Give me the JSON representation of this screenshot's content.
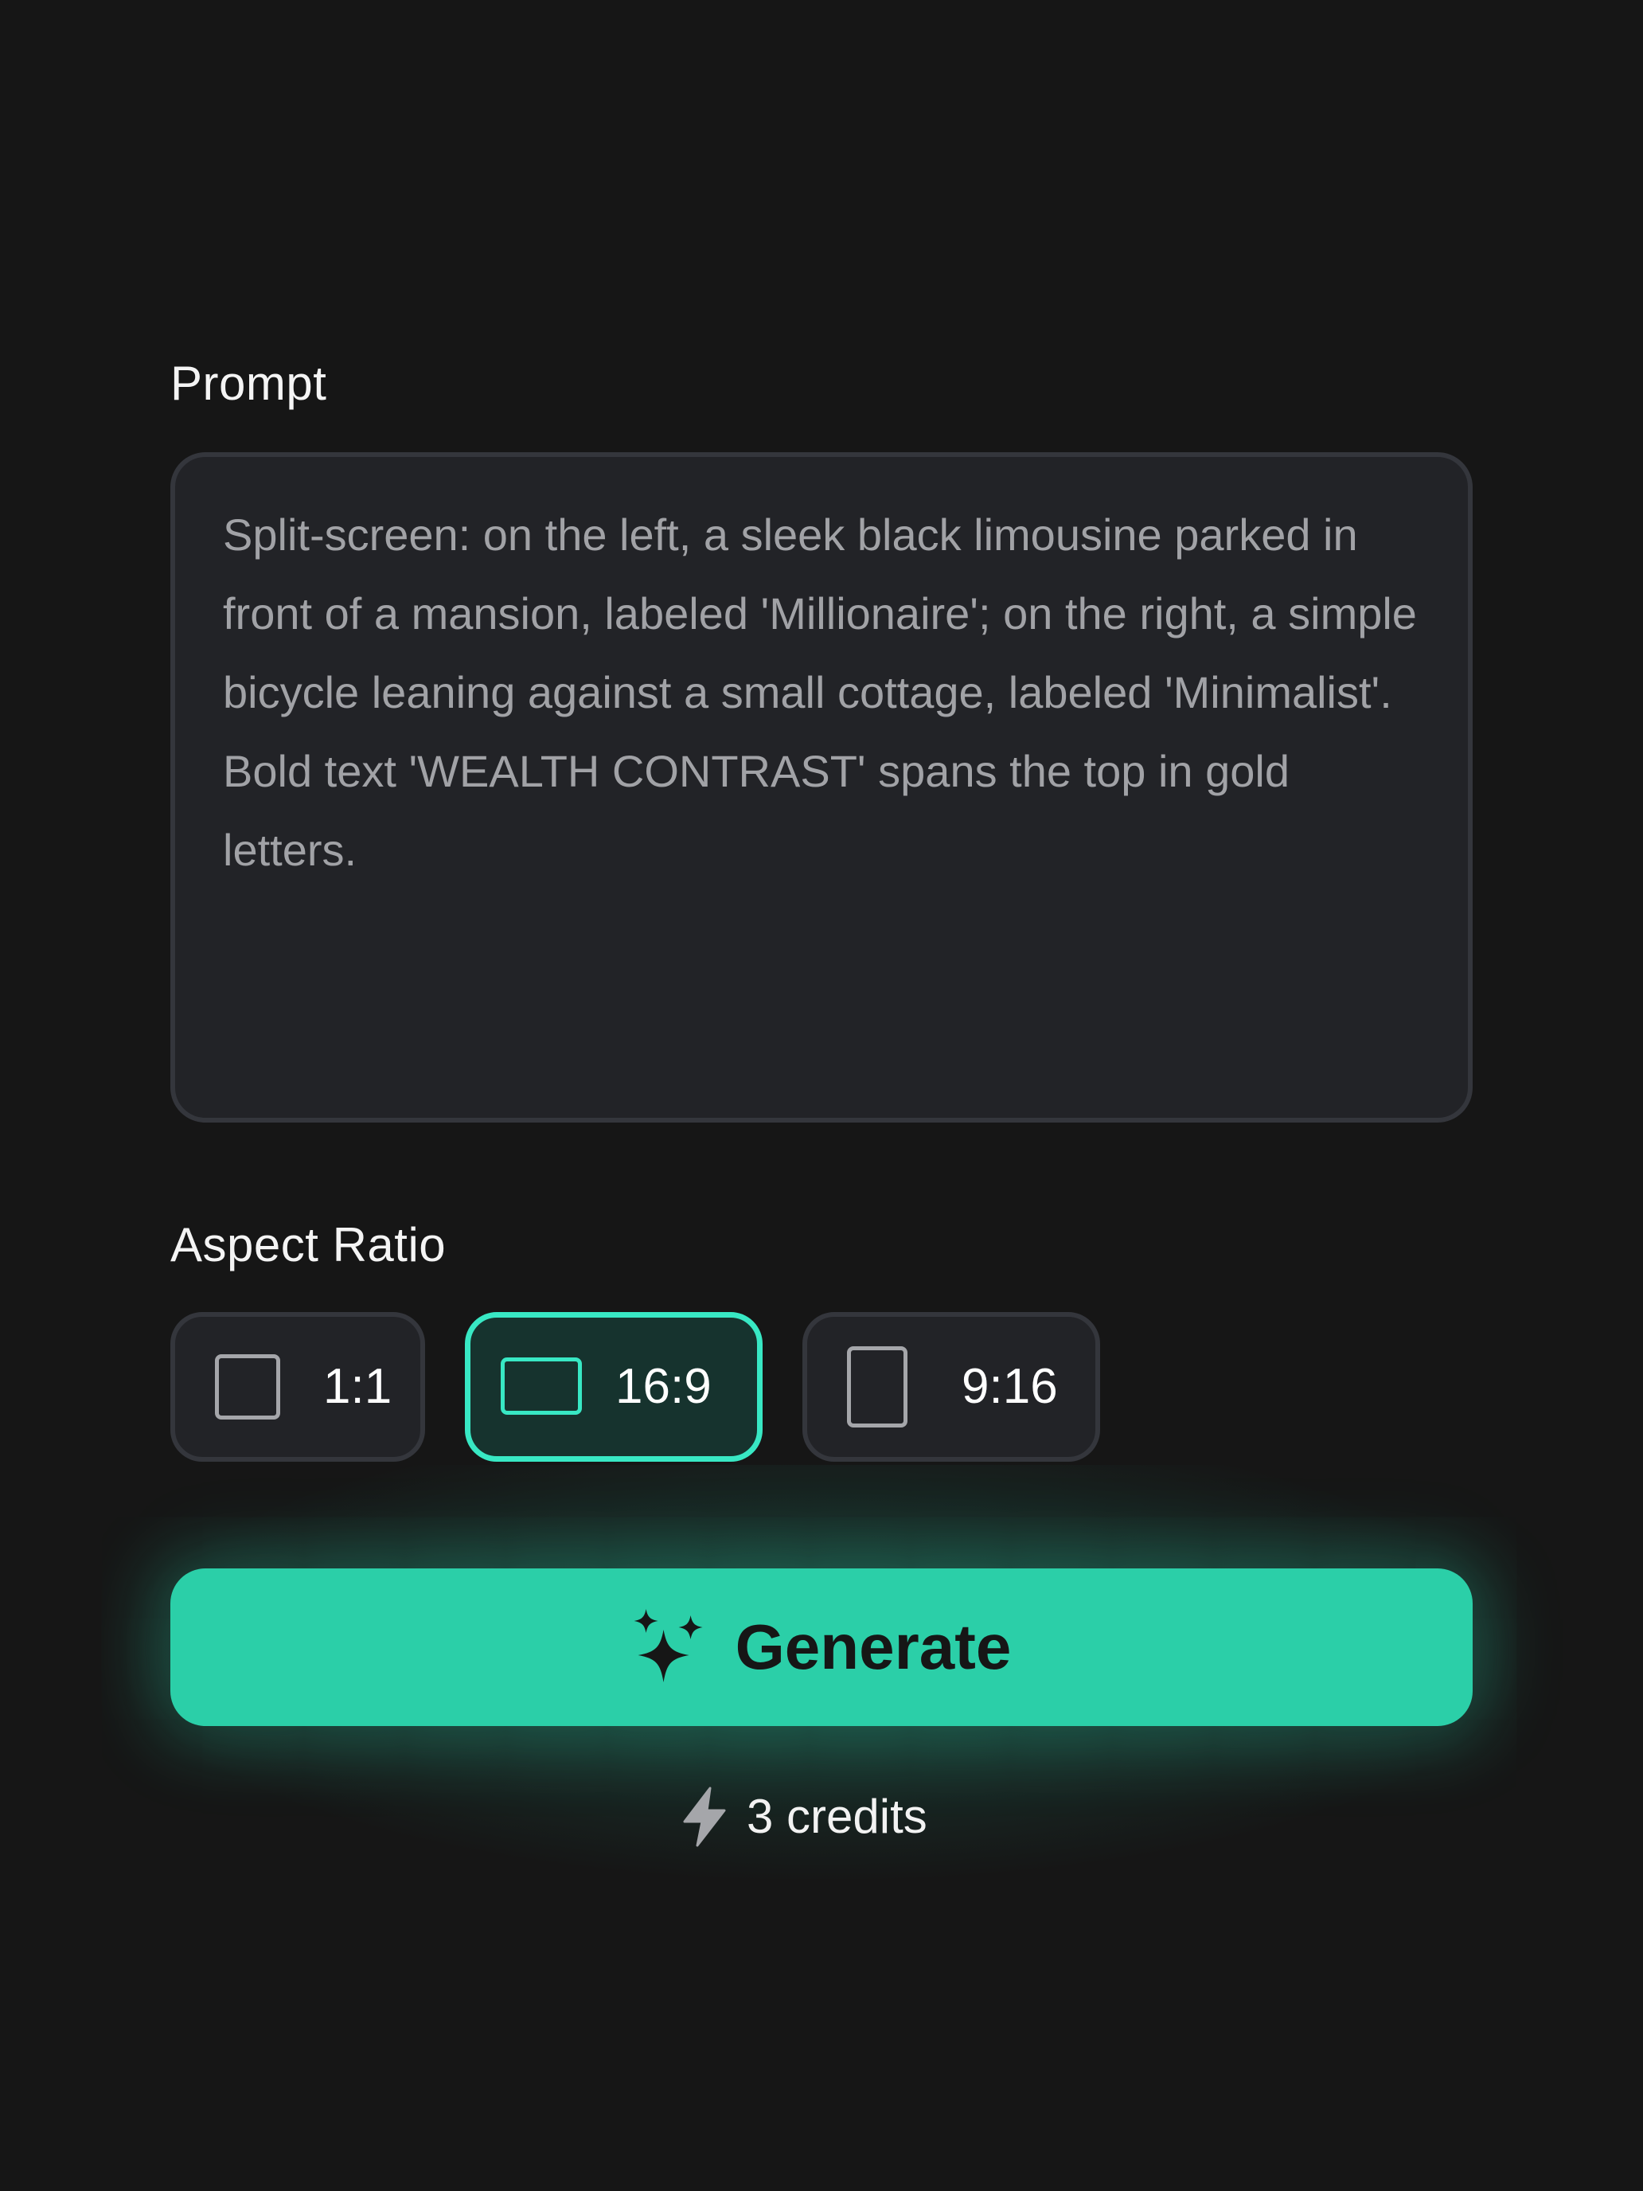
{
  "prompt": {
    "label": "Prompt",
    "value": "Split-screen: on the left, a sleek black limousine parked in front of a mansion, labeled 'Millionaire'; on the right, a simple bicycle leaning against a small cottage, labeled 'Minimalist'. Bold text 'WEALTH CONTRAST' spans the top in gold letters."
  },
  "aspect_ratio": {
    "label": "Aspect Ratio",
    "options": [
      {
        "label": "1:1",
        "icon": "square-icon",
        "selected": false
      },
      {
        "label": "16:9",
        "icon": "landscape-rectangle-icon",
        "selected": true
      },
      {
        "label": "9:16",
        "icon": "portrait-rectangle-icon",
        "selected": false
      }
    ]
  },
  "generate": {
    "label": "Generate",
    "icon": "sparkles-icon"
  },
  "credits": {
    "label": "3 credits",
    "icon": "lightning-bolt-icon"
  },
  "colors": {
    "background": "#161616",
    "panel": "#222327",
    "border": "#34363c",
    "accent": "#2bcfa8",
    "accent_outline": "#38e8c4",
    "prompt_text": "#a1a2a6"
  }
}
